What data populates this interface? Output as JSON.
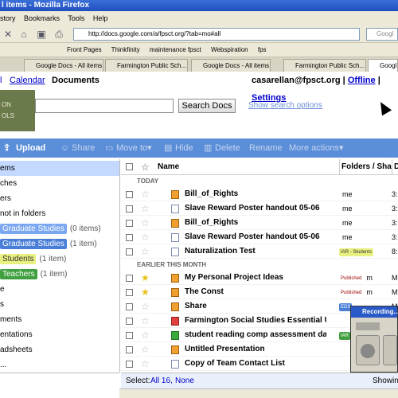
{
  "window": {
    "title": "l items - Mozilla Firefox"
  },
  "menu": [
    "story",
    "Bookmarks",
    "Tools",
    "Help"
  ],
  "nav": {
    "url": "http://docs.google.com/a/fpsct.org/?tab=mo#all",
    "search_placeholder": "Googl"
  },
  "bookmarks": [
    "Front Pages",
    "Thinkfinity",
    "maintenance fpsct",
    "Webspiration",
    "fps"
  ],
  "browser_tabs": [
    "Google Docs - All items",
    "Farmington Public Sch...",
    "Google Docs - All items",
    "Farmington Public Sch...",
    "Googl"
  ],
  "gnav": {
    "mail": "l",
    "calendar": "Calendar",
    "documents": "Documents",
    "email": "casarellan@fpsct.org",
    "offline": "Offline",
    "settings": "Settings"
  },
  "logo_text": [
    "ON",
    "OLS"
  ],
  "search": {
    "button": "Search Docs",
    "options": "Show search options"
  },
  "toolbar": {
    "upload": "Upload",
    "share": "Share",
    "move": "Move to",
    "hide": "Hide",
    "delete": "Delete",
    "rename": "Rename",
    "more": "More actions"
  },
  "sidebar": [
    {
      "label": "ems",
      "selected": true
    },
    {
      "label": "ches"
    },
    {
      "label": "ers"
    },
    {
      "label": "not in folders"
    },
    {
      "tag": "Graduate Studies",
      "count": "(0 items)",
      "color": "#7ba7f0"
    },
    {
      "tag": "Graduate Studies",
      "count": "(1 item)",
      "color": "#4a7fd8"
    },
    {
      "tag": "Students",
      "count": "(1 item)",
      "color": "#e8f080"
    },
    {
      "tag": "Teachers",
      "count": "(1 item)",
      "color": "#40a040"
    },
    {
      "label": "e"
    },
    {
      "label": "s"
    },
    {
      "label": "ments"
    },
    {
      "label": "entations"
    },
    {
      "label": "adsheets"
    },
    {
      "label": "..."
    }
  ],
  "table": {
    "col_name": "Name",
    "col_folders": "Folders / Sha",
    "col_date": "D"
  },
  "sections": {
    "today": "TODAY",
    "earlier": "EARLIER THIS MONTH"
  },
  "rows_today": [
    {
      "name": "Bill_of_Rights",
      "folder": "me",
      "date": "3:",
      "icon": "pres",
      "tag": ""
    },
    {
      "name": "Slave Reward Poster handout 05-06",
      "folder": "me",
      "date": "3:",
      "icon": "doc",
      "tag": ""
    },
    {
      "name": "Bill_of_Rights",
      "folder": "me",
      "date": "3:",
      "icon": "pres",
      "tag": ""
    },
    {
      "name": "Slave Reward Poster handout 05-06",
      "folder": "me",
      "date": "3:",
      "icon": "doc",
      "tag": ""
    },
    {
      "name": "Naturalization Test",
      "folder": "",
      "date": "8:",
      "icon": "doc",
      "tag": "IAR - Students"
    }
  ],
  "rows_earlier": [
    {
      "name": "My Personal Project Ideas",
      "folder": "m",
      "date": "M",
      "icon": "pres",
      "tag": "Published",
      "starred": true
    },
    {
      "name": "The Const",
      "folder": "m",
      "date": "M",
      "icon": "pres",
      "tag": "Published",
      "starred": true
    },
    {
      "name": "Share",
      "folder": "",
      "date": "M",
      "icon": "pres",
      "tag": "EDS",
      "starred": false
    },
    {
      "name": "Farmington Social Studies Essential U",
      "folder": "",
      "date": "",
      "icon": "pdf",
      "tag": "",
      "starred": false
    },
    {
      "name": "student reading comp assessment dat",
      "folder": "",
      "date": "",
      "icon": "sheet",
      "tag": "IAR",
      "starred": false
    },
    {
      "name": "Untitled Presentation",
      "folder": "",
      "date": "",
      "icon": "pres",
      "tag": "",
      "starred": false
    },
    {
      "name": "Copy of Team Contact List",
      "folder": "",
      "date": "",
      "icon": "doc",
      "tag": "",
      "starred": false
    }
  ],
  "footer": {
    "select": "Select:",
    "all": "All 16,",
    "none": "None",
    "showing": "Showin"
  },
  "recorder": {
    "title": "Recording..."
  }
}
